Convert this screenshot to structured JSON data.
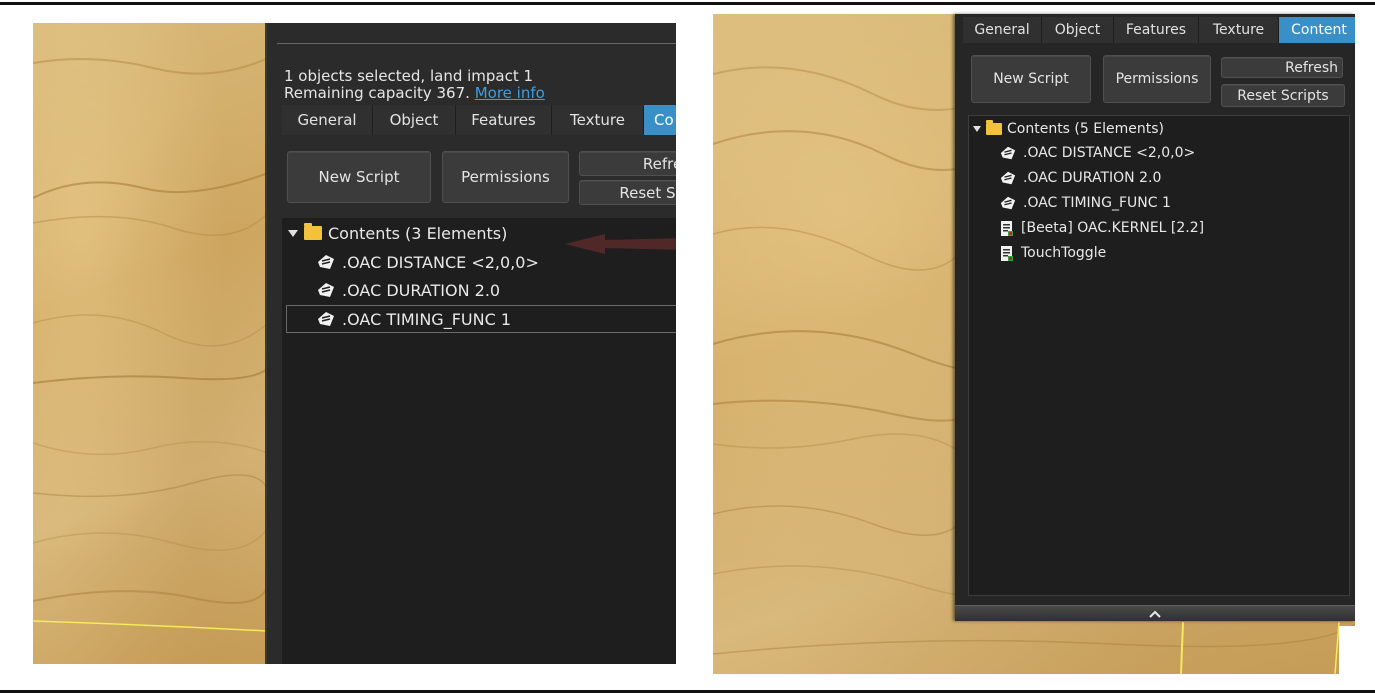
{
  "left": {
    "selection_line": "1 objects selected, land impact 1",
    "capacity_text": "Remaining capacity 367.",
    "more_info_link": "More info",
    "tabs": [
      {
        "label": "General",
        "active": false
      },
      {
        "label": "Object",
        "active": false
      },
      {
        "label": "Features",
        "active": false
      },
      {
        "label": "Texture",
        "active": false
      },
      {
        "label": "Co",
        "active": true
      }
    ],
    "buttons": {
      "new_script": "New Script",
      "permissions": "Permissions",
      "refresh": "Refres",
      "reset_scripts": "Reset Scr"
    },
    "contents_header": "Contents (3 Elements)",
    "items": [
      {
        "label": ".OAC DISTANCE <2,0,0>",
        "icon": "notecard-icon"
      },
      {
        "label": ".OAC DURATION 2.0",
        "icon": "notecard-icon"
      },
      {
        "label": ".OAC TIMING_FUNC 1",
        "icon": "notecard-icon",
        "selected": true
      }
    ]
  },
  "right": {
    "tabs": [
      {
        "label": "General",
        "active": false
      },
      {
        "label": "Object",
        "active": false
      },
      {
        "label": "Features",
        "active": false
      },
      {
        "label": "Texture",
        "active": false
      },
      {
        "label": "Content",
        "active": true
      }
    ],
    "buttons": {
      "new_script": "New Script",
      "permissions": "Permissions",
      "refresh": "Refresh",
      "reset_scripts": "Reset Scripts"
    },
    "contents_header": "Contents (5 Elements)",
    "items": [
      {
        "label": ".OAC DISTANCE <2,0,0>",
        "icon": "notecard-icon"
      },
      {
        "label": ".OAC DURATION 2.0",
        "icon": "notecard-icon"
      },
      {
        "label": ".OAC TIMING_FUNC 1",
        "icon": "notecard-icon"
      },
      {
        "label": "[Beeta] OAC.KERNEL [2.2]",
        "icon": "script-icon"
      },
      {
        "label": "TouchToggle",
        "icon": "script-icon"
      }
    ],
    "collapse_icon": "chevron-up-icon"
  },
  "colors": {
    "panel_bg": "#2b2b2b",
    "list_bg": "#1e1e1e",
    "active_tab": "#3a8fc7",
    "link": "#3d9de0",
    "folder": "#f2c23c",
    "arrow": "#5a2a2a"
  }
}
